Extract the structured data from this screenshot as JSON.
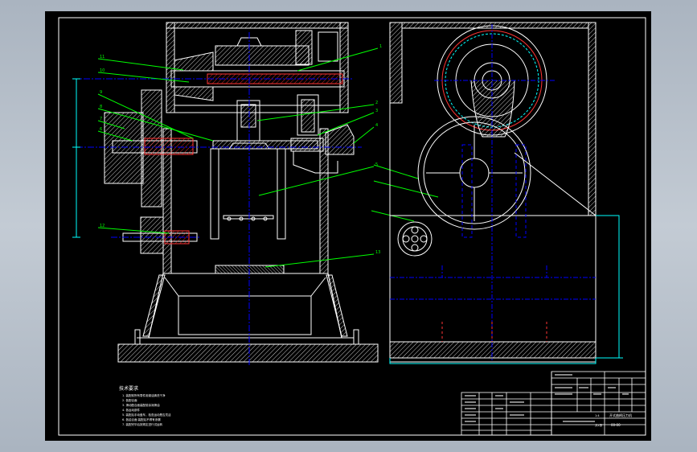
{
  "drawing": {
    "notes_heading": "技术要求",
    "notes": [
      "1. 装配前所有零件用煤油清洗干净",
      "2. 各配合面",
      "3. 滑动配合面装配前涂润滑油",
      "4. 各运动部件",
      "5. 装配后手动盘车，检查运动是否灵活",
      "6. 各结合面 装配后不得有渗漏",
      "7. 装配完毕后按规定进行试运转"
    ],
    "title_block": {
      "title": "开式曲柄压力机",
      "drawing_no": "00-00",
      "scale": "1:4",
      "sheet": "共1张"
    }
  },
  "colors": {
    "background": "#000000",
    "outline": "#ffffff",
    "leader": "#00ff00",
    "centerline": "#0000ff",
    "hidden": "#ff3333",
    "dimension": "#00ffff",
    "hatch": "#ffffff"
  }
}
